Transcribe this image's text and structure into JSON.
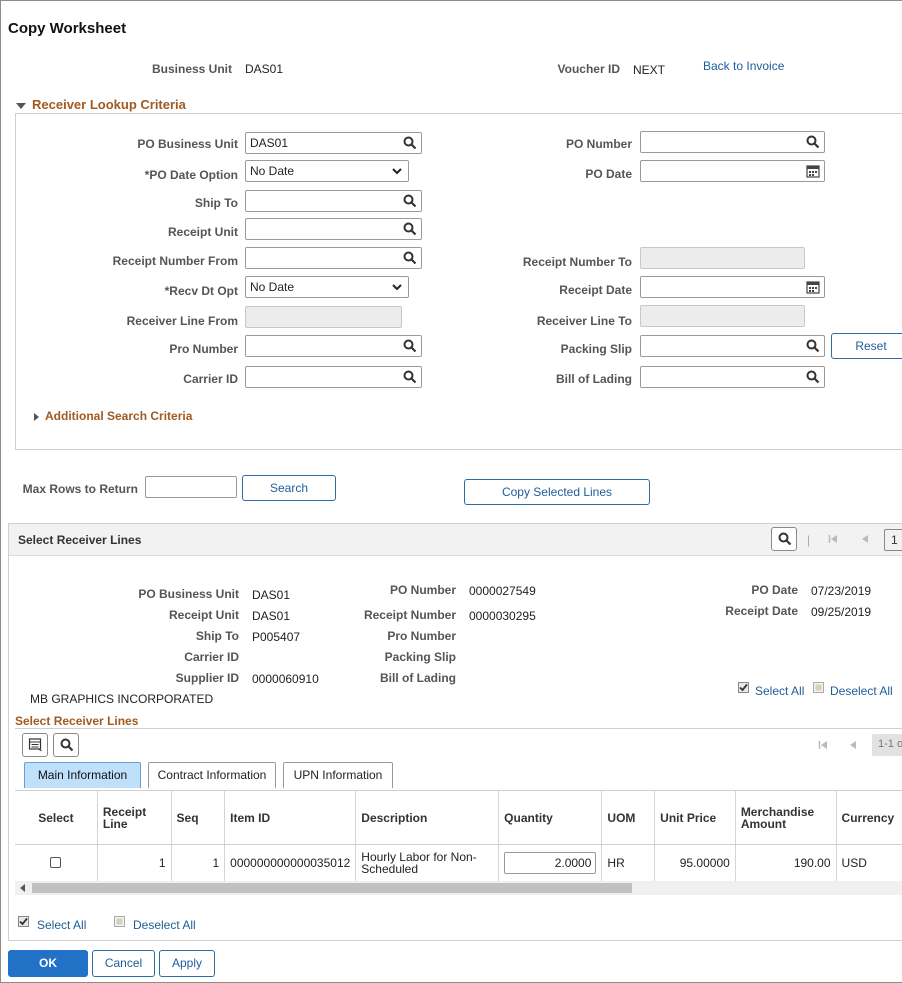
{
  "page": {
    "title": "Copy Worksheet",
    "business_unit_label": "Business Unit",
    "business_unit_value": "DAS01",
    "voucher_id_label": "Voucher ID",
    "voucher_id_value": "NEXT",
    "back_link": "Back to Invoice"
  },
  "criteria": {
    "section_title": "Receiver Lookup Criteria",
    "po_business_unit_label": "PO Business Unit",
    "po_business_unit_value": "DAS01",
    "po_date_option_label": "*PO Date Option",
    "po_date_option_value": "No Date",
    "ship_to_label": "Ship To",
    "receipt_unit_label": "Receipt Unit",
    "receipt_number_from_label": "Receipt Number From",
    "recv_dt_opt_label": "*Recv Dt Opt",
    "recv_dt_opt_value": "No Date",
    "receiver_line_from_label": "Receiver Line From",
    "pro_number_label": "Pro Number",
    "carrier_id_label": "Carrier ID",
    "po_number_label": "PO Number",
    "po_date_label": "PO Date",
    "receipt_number_to_label": "Receipt Number To",
    "receipt_date_label": "Receipt Date",
    "receiver_line_to_label": "Receiver Line To",
    "packing_slip_label": "Packing Slip",
    "bill_of_lading_label": "Bill of Lading",
    "reset_label": "Reset",
    "additional_label": "Additional Search Criteria"
  },
  "search": {
    "max_rows_label": "Max Rows to Return",
    "search_label": "Search",
    "copy_label": "Copy Selected Lines"
  },
  "receiver": {
    "header": "Select Receiver Lines",
    "page_num": "1",
    "po_business_unit_label": "PO Business Unit",
    "po_business_unit_value": "DAS01",
    "receipt_unit_label": "Receipt Unit",
    "receipt_unit_value": "DAS01",
    "ship_to_label": "Ship To",
    "ship_to_value": "P005407",
    "carrier_id_label": "Carrier ID",
    "supplier_id_label": "Supplier ID",
    "supplier_id_value": "0000060910",
    "supplier_name": "MB GRAPHICS INCORPORATED",
    "po_number_label": "PO Number",
    "po_number_value": "0000027549",
    "receipt_number_label": "Receipt Number",
    "receipt_number_value": "0000030295",
    "pro_number_label": "Pro Number",
    "packing_slip_label": "Packing Slip",
    "bill_of_lading_label": "Bill of Lading",
    "po_date_label": "PO Date",
    "po_date_value": "07/23/2019",
    "receipt_date_label": "Receipt Date",
    "receipt_date_value": "09/25/2019",
    "select_all": "Select All",
    "deselect_all": "Deselect All"
  },
  "lines": {
    "title": "Select Receiver Lines",
    "pager": "1-1 o",
    "tabs": [
      "Main Information",
      "Contract Information",
      "UPN Information"
    ],
    "columns": [
      "Select",
      "Receipt Line",
      "Seq",
      "Item ID",
      "Description",
      "Quantity",
      "UOM",
      "Unit Price",
      "Merchandise Amount",
      "Currency"
    ],
    "rows": [
      {
        "receipt_line": "1",
        "seq": "1",
        "item_id": "000000000000035012",
        "description": "Hourly Labor for Non-Scheduled",
        "quantity": "2.0000",
        "uom": "HR",
        "unit_price": "95.00000",
        "merchandise_amount": "190.00",
        "currency": "USD"
      }
    ],
    "select_all": "Select All",
    "deselect_all": "Deselect All"
  },
  "footer": {
    "ok": "OK",
    "cancel": "Cancel",
    "apply": "Apply"
  },
  "colors": {
    "accent": "#2171c7",
    "section_title": "#a05a22",
    "link": "#1f5d99",
    "active_tab": "#bfe0fb"
  }
}
